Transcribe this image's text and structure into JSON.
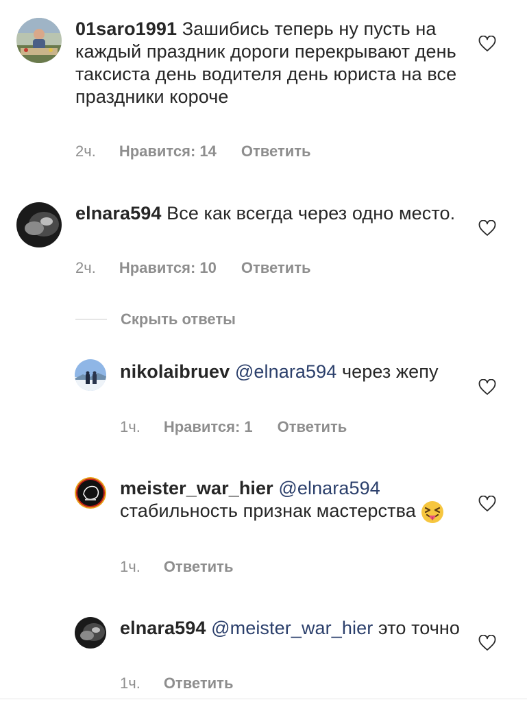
{
  "comments": [
    {
      "username": "01saro1991",
      "text": "Зашибись теперь ну пусть на каждый праздник дороги перекрывают день таксиста день водителя день юриста на все праздники короче",
      "time": "2ч.",
      "likes": "Нравится: 14",
      "reply": "Ответить"
    },
    {
      "username": "elnara594",
      "text": "Все как всегда через одно место.",
      "time": "2ч.",
      "likes": "Нравится: 10",
      "reply": "Ответить"
    }
  ],
  "hide_replies_label": "Скрыть ответы",
  "replies": [
    {
      "username": "nikolaibruev",
      "mention": "@elnara594",
      "text": "через жепу",
      "time": "1ч.",
      "likes": "Нравится: 1",
      "reply": "Ответить"
    },
    {
      "username": "meister_war_hier",
      "mention": "@elnara594",
      "text": "стабильность признак мастерства",
      "emoji": "squinting-face-with-tongue",
      "time": "1ч.",
      "reply": "Ответить"
    },
    {
      "username": "elnara594",
      "mention": "@meister_war_hier",
      "text": "это точно",
      "time": "1ч.",
      "reply": "Ответить"
    }
  ],
  "icons": {
    "like": "heart-outline-icon"
  },
  "colors": {
    "mention": "#2b3f6b",
    "meta": "#8e8e8e",
    "text": "#262626"
  }
}
